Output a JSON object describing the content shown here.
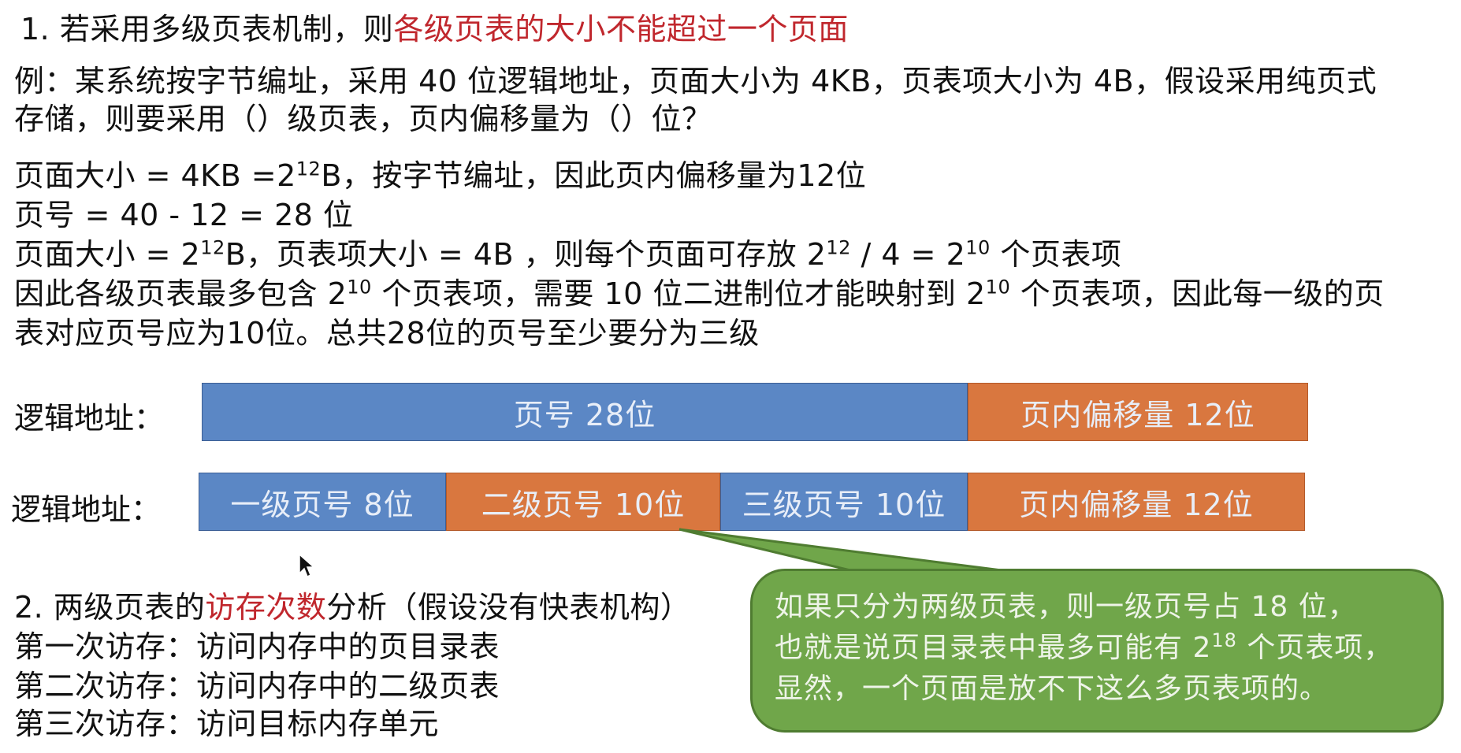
{
  "heading1": {
    "prefix": "1. 若采用多级页表机制，则",
    "highlight": "各级页表的大小不能超过一个页面"
  },
  "example": {
    "line1": "例：某系统按字节编址，采用 40 位逻辑地址，页面大小为 4KB，页表项大小为 4B，假设采用纯页式",
    "line2": "存储，则要采用（）级页表，页内偏移量为（）位？"
  },
  "solution": {
    "l1a": "页面大小 = 4KB =2",
    "l1sup": "12",
    "l1b": "B，按字节编址，因此页内偏移量为12位",
    "l2": "页号 = 40 - 12 = 28 位",
    "l3a": "页面大小 = 2",
    "l3sup1": "12",
    "l3b": "B，页表项大小 = 4B ，则每个页面可存放 2",
    "l3sup2": "12",
    "l3c": " / 4  = 2",
    "l3sup3": "10",
    "l3d": " 个页表项",
    "l4a": "因此各级页表最多包含 2",
    "l4sup1": "10",
    "l4b": " 个页表项，需要 10 位二进制位才能映射到 2",
    "l4sup2": "10",
    "l4c": " 个页表项，因此每一级的页",
    "l5": "表对应页号应为10位。总共28位的页号至少要分为三级"
  },
  "diagram": {
    "row1_label": "逻辑地址：",
    "row1": [
      "页号  28位",
      "页内偏移量 12位"
    ],
    "row2_label": "逻辑地址：",
    "row2": [
      "一级页号 8位",
      "二级页号 10位",
      "三级页号 10位",
      "页内偏移量 12位"
    ]
  },
  "heading2": {
    "prefix": "2. 两级页表的",
    "highlight": "访存次数",
    "suffix": "分析（假设没有快表机构）"
  },
  "accesses": [
    "第一次访存：访问内存中的页目录表",
    "第二次访存：访问内存中的二级页表",
    "第三次访存：访问目标内存单元"
  ],
  "callout": {
    "l1": "如果只分为两级页表，则一级页号占 18 位，",
    "l2a": "也就是说页目录表中最多可能有 2",
    "l2sup": "18",
    "l2b": " 个页表项，",
    "l3": "显然，一个页面是放不下这么多页表项的。"
  },
  "colors": {
    "highlight": "#c0272d",
    "blue_segment": "#5b87c5",
    "orange_segment": "#d9773f",
    "callout": "#70a64a"
  }
}
